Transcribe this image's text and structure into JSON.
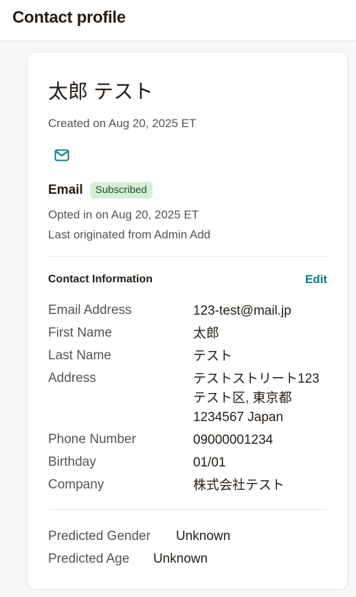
{
  "header": {
    "title": "Contact profile"
  },
  "contact": {
    "name": "太郎 テスト",
    "created": "Created on Aug 20, 2025 ET"
  },
  "email_status": {
    "icon": "mail-icon",
    "label": "Email",
    "badge": "Subscribed",
    "opted_in": "Opted in on Aug 20, 2025 ET",
    "originated": "Last originated from Admin Add"
  },
  "contact_info": {
    "title": "Contact Information",
    "edit_label": "Edit",
    "fields": [
      {
        "label": "Email Address",
        "value": "123-test@mail.jp"
      },
      {
        "label": "First Name",
        "value": "太郎"
      },
      {
        "label": "Last Name",
        "value": "テスト"
      },
      {
        "label": "Address",
        "value": [
          "テストストリート123",
          "テスト区, 東京都",
          "1234567 Japan"
        ]
      },
      {
        "label": "Phone Number",
        "value": "09000001234"
      },
      {
        "label": "Birthday",
        "value": "01/01"
      },
      {
        "label": "Company",
        "value": "株式会社テスト"
      }
    ]
  },
  "predictions": [
    {
      "label": "Predicted Gender",
      "value": "Unknown"
    },
    {
      "label": "Predicted Age",
      "value": "Unknown"
    }
  ],
  "colors": {
    "accent": "#007c89",
    "badge_bg": "#d3f0d6",
    "badge_text": "#1f4d2b"
  }
}
